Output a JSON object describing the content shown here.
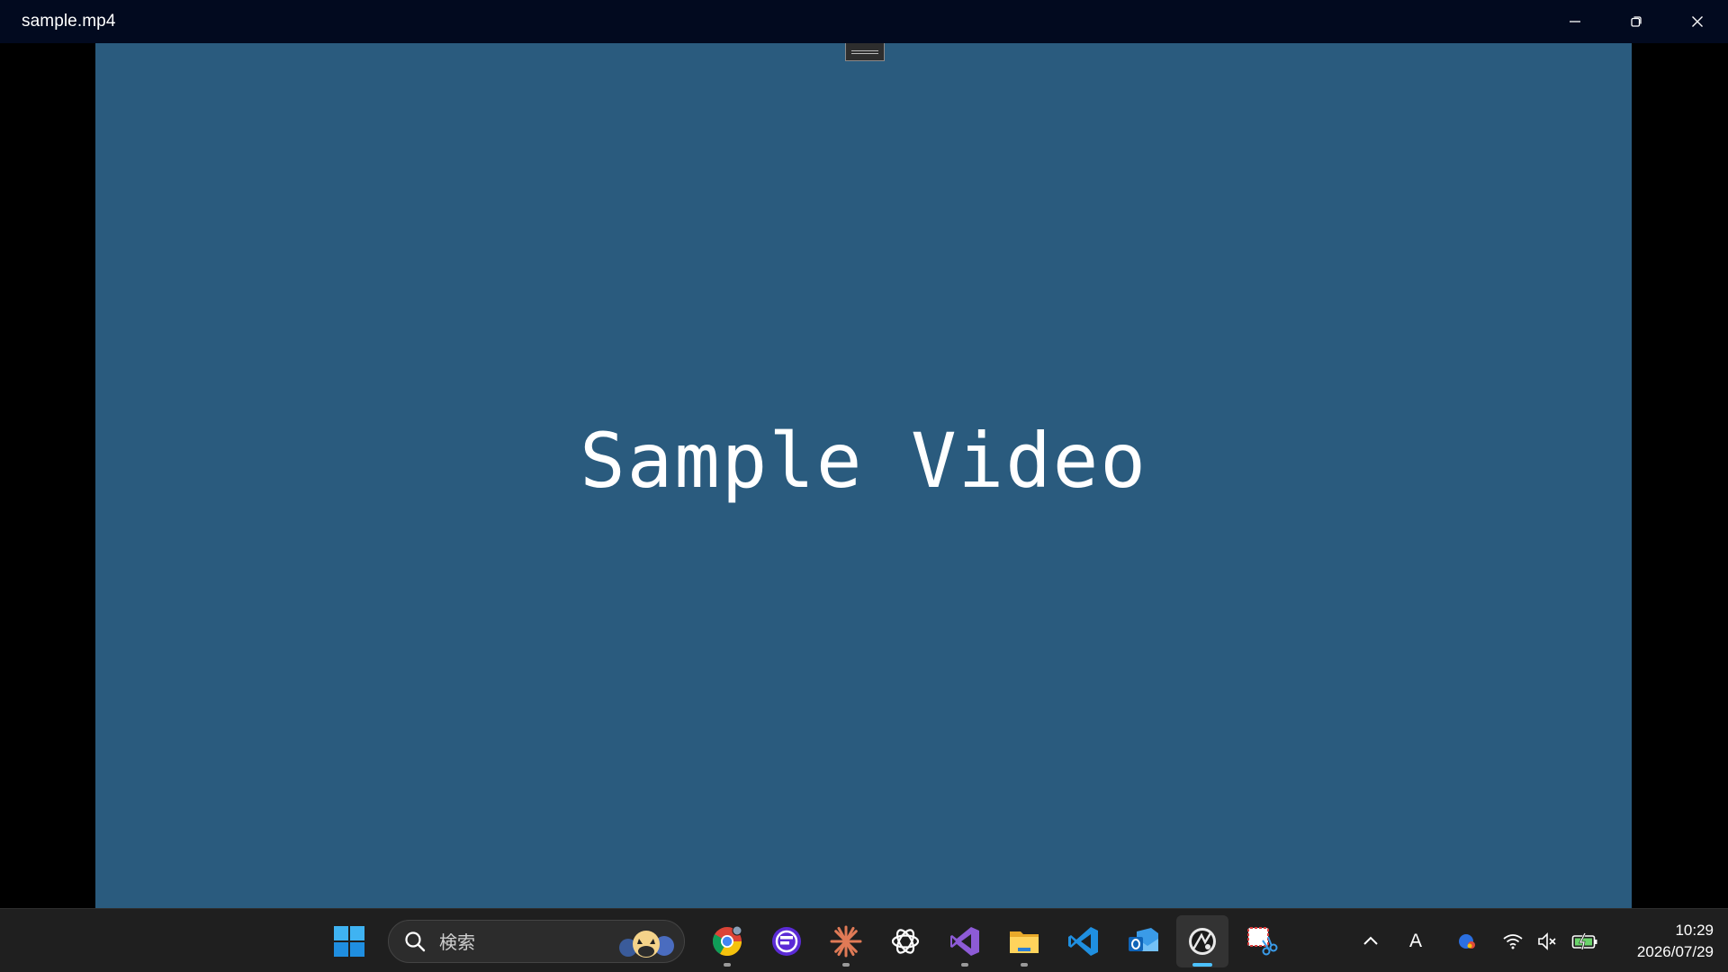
{
  "window": {
    "title": "sample.mp4",
    "controls": {
      "minimize": "minimize-icon",
      "restore": "restore-icon",
      "close": "close-icon"
    }
  },
  "video": {
    "caption": "Sample Video",
    "background": "#2a5b7e"
  },
  "taskbar": {
    "search": {
      "placeholder": "検索"
    },
    "apps": [
      {
        "name": "windows-start",
        "icon": "windows-logo-icon"
      },
      {
        "name": "chrome",
        "icon": "chrome-icon",
        "running": true
      },
      {
        "name": "app-f",
        "icon": "f-app-icon"
      },
      {
        "name": "claude",
        "icon": "claude-icon",
        "running": true
      },
      {
        "name": "chatgpt",
        "icon": "chatgpt-icon"
      },
      {
        "name": "visual-studio",
        "icon": "visual-studio-icon",
        "running": true
      },
      {
        "name": "file-explorer",
        "icon": "folder-icon",
        "running": true
      },
      {
        "name": "vscode",
        "icon": "vscode-icon"
      },
      {
        "name": "outlook",
        "icon": "outlook-icon"
      },
      {
        "name": "media-player",
        "icon": "media-player-icon",
        "active": true
      },
      {
        "name": "snipping-tool",
        "icon": "snipping-tool-icon"
      }
    ],
    "tray": {
      "ime": "A",
      "clock": {
        "time": "10:29",
        "date": "2026/07/29"
      }
    }
  }
}
